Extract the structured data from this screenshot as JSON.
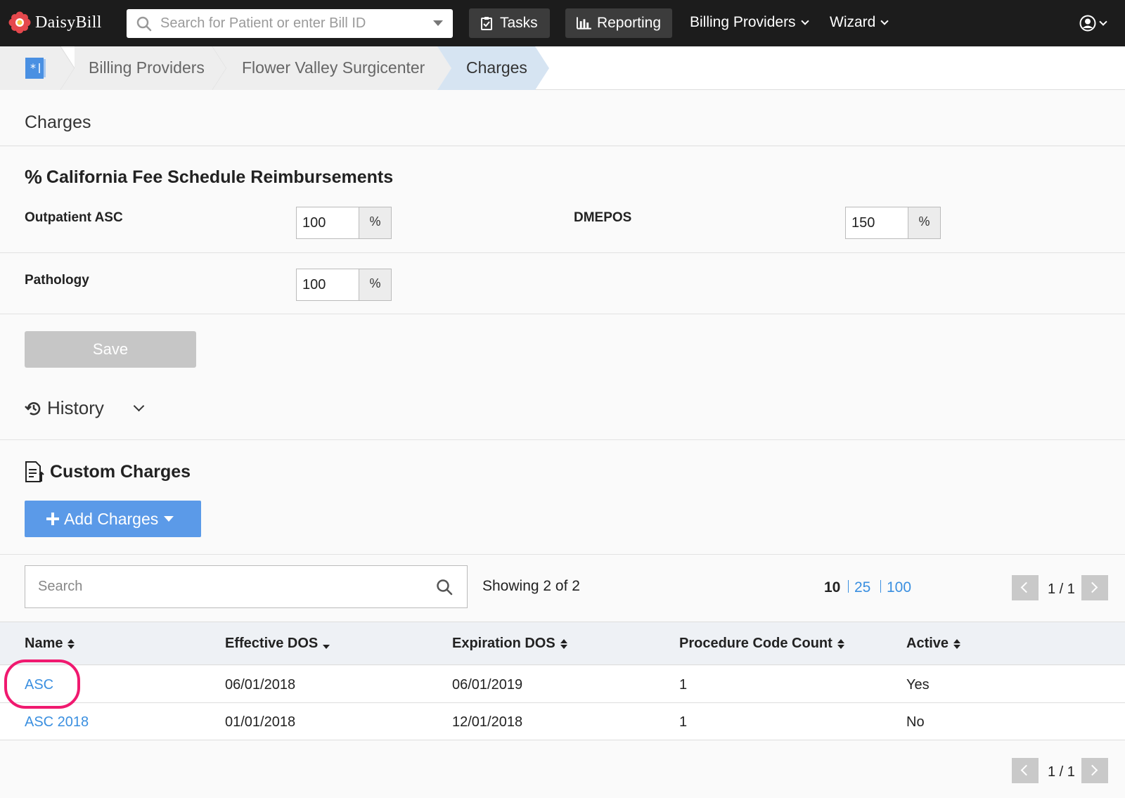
{
  "app": {
    "brand": "DaisyBill",
    "search_placeholder": "Search for Patient or enter Bill ID",
    "nav": {
      "tasks": "Tasks",
      "reporting": "Reporting",
      "billing_providers": "Billing Providers",
      "wizard": "Wizard"
    }
  },
  "breadcrumb": [
    "Billing Providers",
    "Flower Valley Surgicenter",
    "Charges"
  ],
  "page_title": "Charges",
  "fee_schedule": {
    "heading": "California Fee Schedule Reimbursements",
    "fields": {
      "outpatient_asc": {
        "label": "Outpatient ASC",
        "value": "100",
        "unit": "%"
      },
      "dmepos": {
        "label": "DMEPOS",
        "value": "150",
        "unit": "%"
      },
      "pathology": {
        "label": "Pathology",
        "value": "100",
        "unit": "%"
      }
    },
    "save_label": "Save"
  },
  "history_label": "History",
  "custom_charges": {
    "heading": "Custom Charges",
    "add_label": "Add Charges",
    "search_placeholder": "Search",
    "showing": "Showing 2 of 2",
    "page_sizes": [
      "10",
      "25",
      "100"
    ],
    "page_indicator": "1 / 1",
    "columns": [
      "Name",
      "Effective DOS",
      "Expiration DOS",
      "Procedure Code Count",
      "Active"
    ],
    "rows": [
      {
        "name": "ASC",
        "effective": "06/01/2018",
        "expiration": "06/01/2019",
        "count": "1",
        "active": "Yes"
      },
      {
        "name": "ASC 2018",
        "effective": "01/01/2018",
        "expiration": "12/01/2018",
        "count": "1",
        "active": "No"
      }
    ]
  },
  "colors": {
    "navbar": "#1c1c1c",
    "link": "#3a8fe0",
    "primary_button": "#5b9ae8",
    "highlight": "#f0196f",
    "active_crumb": "#d6e4f2"
  },
  "icons": [
    "search-icon",
    "clipboard-check-icon",
    "bar-chart-icon",
    "user-circle-icon",
    "provider-card-icon",
    "percent-icon",
    "history-icon",
    "document-icon",
    "plus-icon"
  ]
}
